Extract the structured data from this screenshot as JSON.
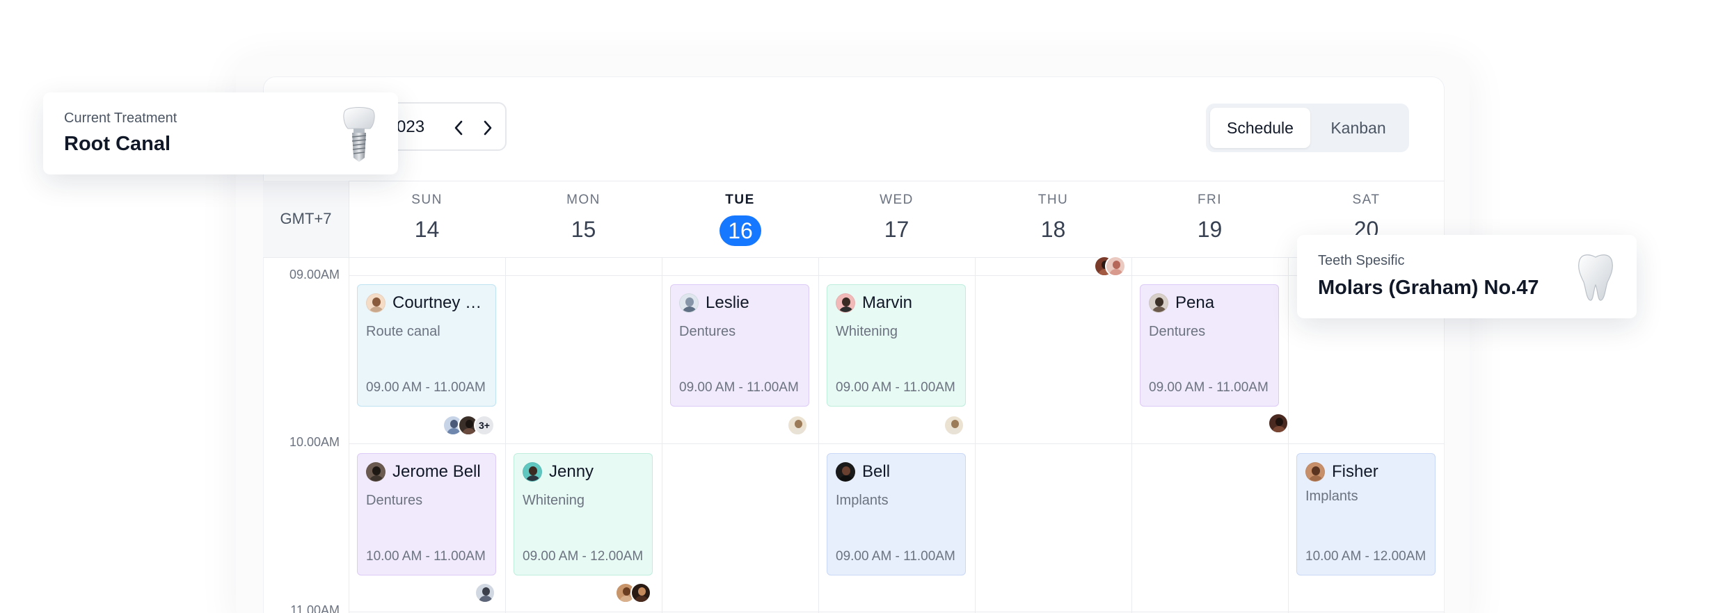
{
  "header": {
    "date_partial": "023",
    "views": {
      "schedule": "Schedule",
      "kanban": "Kanban"
    }
  },
  "grid": {
    "timezone": "GMT+7",
    "days": [
      {
        "name": "SUN",
        "num": "14"
      },
      {
        "name": "MON",
        "num": "15"
      },
      {
        "name": "TUE",
        "num": "16",
        "today": true
      },
      {
        "name": "WED",
        "num": "17"
      },
      {
        "name": "THU",
        "num": "18"
      },
      {
        "name": "FRI",
        "num": "19"
      },
      {
        "name": "SAT",
        "num": "20"
      }
    ],
    "times": [
      "09.00AM",
      "10.00AM",
      "11.00AM"
    ]
  },
  "appointments": [
    {
      "name": "Courtney H...",
      "service": "Route canal",
      "time": "09.00 AM - 11.00AM"
    },
    {
      "name": "Leslie",
      "service": "Dentures",
      "time": "09.00 AM - 11.00AM"
    },
    {
      "name": "Marvin",
      "service": "Whitening",
      "time": "09.00 AM - 11.00AM"
    },
    {
      "name": "Pena",
      "service": "Dentures",
      "time": "09.00 AM - 11.00AM"
    },
    {
      "name": "Jerome Bell",
      "service": "Dentures",
      "time": "10.00 AM - 11.00AM"
    },
    {
      "name": "Jenny",
      "service": "Whitening",
      "time": "09.00 AM - 12.00AM"
    },
    {
      "name": "Bell",
      "service": "Implants",
      "time": "09.00 AM - 11.00AM"
    },
    {
      "name": "Fisher",
      "service": "Implants",
      "time": "10.00 AM - 12.00AM"
    }
  ],
  "more_count": "3+",
  "current_treatment": {
    "label": "Current Treatment",
    "value": "Root Canal"
  },
  "teeth_specific": {
    "label": "Teeth Spesific",
    "value": "Molars (Graham) No.47"
  },
  "colors": {
    "accent": "#1677ff",
    "blue": "#ebf6fb",
    "purple": "#f1eafc",
    "green": "#e8faf4",
    "indigo": "#e8effc"
  },
  "icons": [
    "chevron-left-icon",
    "chevron-right-icon",
    "dental-implant-icon",
    "tooth-icon"
  ]
}
